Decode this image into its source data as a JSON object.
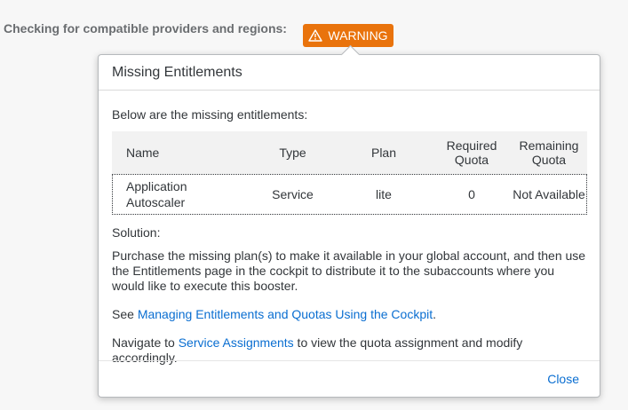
{
  "check": {
    "label": "Checking for compatible providers and regions:",
    "badge_label": "WARNING",
    "badge_color": "#e9730c",
    "badge_icon": "warning-triangle-icon"
  },
  "popover": {
    "title": "Missing Entitlements",
    "intro": "Below are the missing entitlements:",
    "table": {
      "headers": {
        "name": "Name",
        "type": "Type",
        "plan": "Plan",
        "required_line1": "Required",
        "required_line2": "Quota",
        "remaining_line1": "Remaining",
        "remaining_line2": "Quota"
      },
      "rows": [
        {
          "name_line1": "Application",
          "name_line2": "Autoscaler",
          "type": "Service",
          "plan": "lite",
          "required": "0",
          "remaining": "Not Available"
        }
      ]
    },
    "solution_label": "Solution:",
    "solution_text_line1": "Purchase the missing plan(s) to make it available in your global account, and then use",
    "solution_text_line2": "the Entitlements page in the cockpit to distribute it to the subaccounts where you",
    "solution_text_line3": "would like to execute this booster.",
    "see_prefix": "See ",
    "see_link": "Managing Entitlements and Quotas Using the Cockpit",
    "see_suffix": ".",
    "nav_prefix": "Navigate to ",
    "nav_link": "Service Assignments",
    "nav_suffix": " to view the quota assignment and modify accordingly.",
    "close_label": "Close",
    "link_color": "#0a6ed1"
  }
}
